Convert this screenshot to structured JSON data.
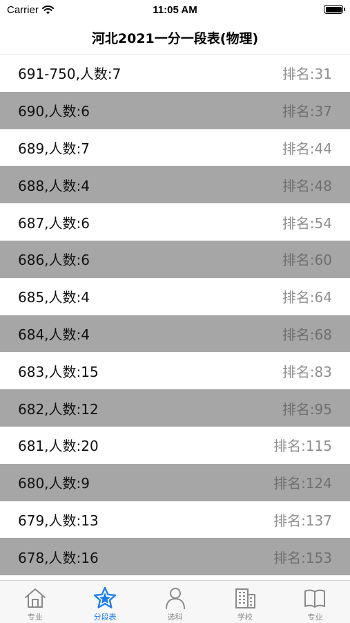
{
  "status_bar": {
    "carrier": "Carrier",
    "time": "11:05 AM"
  },
  "nav": {
    "title": "河北2021一分一段表(物理)"
  },
  "rows": [
    {
      "left": "691-750,人数:7",
      "right": "排名:31"
    },
    {
      "left": "690,人数:6",
      "right": "排名:37"
    },
    {
      "left": "689,人数:7",
      "right": "排名:44"
    },
    {
      "left": "688,人数:4",
      "right": "排名:48"
    },
    {
      "left": "687,人数:6",
      "right": "排名:54"
    },
    {
      "left": "686,人数:6",
      "right": "排名:60"
    },
    {
      "left": "685,人数:4",
      "right": "排名:64"
    },
    {
      "left": "684,人数:4",
      "right": "排名:68"
    },
    {
      "left": "683,人数:15",
      "right": "排名:83"
    },
    {
      "left": "682,人数:12",
      "right": "排名:95"
    },
    {
      "left": "681,人数:20",
      "right": "排名:115"
    },
    {
      "left": "680,人数:9",
      "right": "排名:124"
    },
    {
      "left": "679,人数:13",
      "right": "排名:137"
    },
    {
      "left": "678,人数:16",
      "right": "排名:153"
    }
  ],
  "tabs": [
    {
      "label": "专业",
      "icon": "home-icon"
    },
    {
      "label": "分段表",
      "icon": "star-icon",
      "active": true
    },
    {
      "label": "选科",
      "icon": "person-icon"
    },
    {
      "label": "学校",
      "icon": "building-icon"
    },
    {
      "label": "专业",
      "icon": "book-icon"
    }
  ],
  "colors": {
    "accent": "#1a7cf5",
    "alt_row": "#a6a6a6",
    "inactive_tab": "#8a8a8a"
  }
}
